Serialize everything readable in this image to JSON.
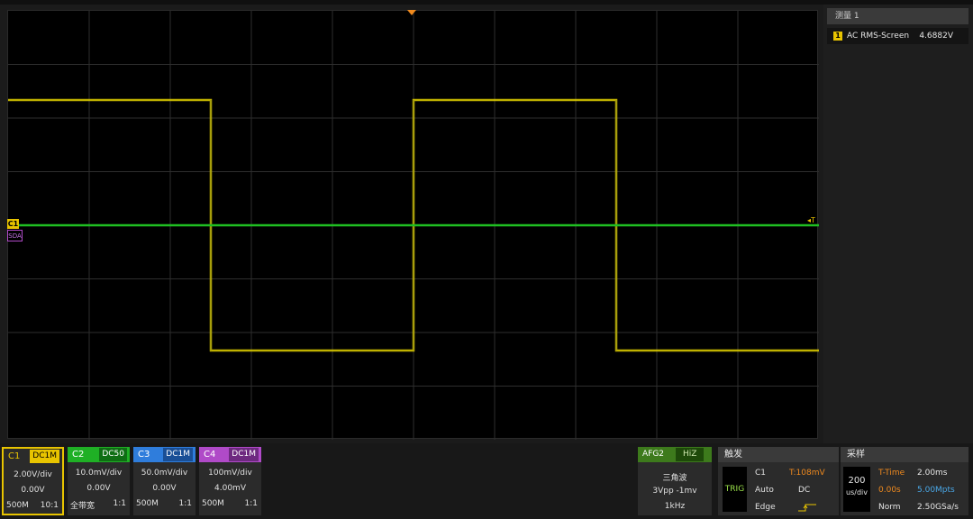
{
  "measurement": {
    "title": "测量 1",
    "channel_badge": "1",
    "name": "AC RMS-Screen",
    "value": "4.6882V"
  },
  "waveform": {
    "channel_marker": "C1",
    "bus_label": "SDA",
    "trigger_level_marker": "◂T",
    "colors": {
      "ch1": "#e0d000",
      "ch2": "#1fbf22",
      "grid": "#2e2e2e"
    }
  },
  "channels": [
    {
      "name": "C1",
      "coupling": "DC1M",
      "scale": "2.00V/div",
      "offset": "0.00V",
      "bandwidth": "500M",
      "probe": "10:1",
      "color": "#e8c400",
      "active": true
    },
    {
      "name": "C2",
      "coupling": "DC50",
      "scale": "10.0mV/div",
      "offset": "0.00V",
      "bandwidth": "全带宽",
      "probe": "1:1",
      "color": "#1fb025",
      "active": false
    },
    {
      "name": "C3",
      "coupling": "DC1M",
      "scale": "50.0mV/div",
      "offset": "0.00V",
      "bandwidth": "500M",
      "probe": "1:1",
      "color": "#2f7ddc",
      "active": false
    },
    {
      "name": "C4",
      "coupling": "DC1M",
      "scale": "100mV/div",
      "offset": "4.00mV",
      "bandwidth": "500M",
      "probe": "1:1",
      "color": "#b04ac8",
      "active": false
    }
  ],
  "afg": {
    "name": "AFG2",
    "impedance": "HiZ",
    "wave": "三角波",
    "amplitude": "3Vpp -1mv",
    "frequency": "1kHz"
  },
  "trigger": {
    "title": "触发",
    "tag": "TRIG",
    "source": "C1",
    "level": "T:108mV",
    "mode": "Auto",
    "coupling": "DC",
    "type": "Edge"
  },
  "acquire": {
    "title": "采样",
    "timebase_value": "200",
    "timebase_unit": "us/div",
    "ttime_label": "T-Time",
    "ttime_value": "2.00ms",
    "delay": "0.00s",
    "memory": "5.00Mpts",
    "mode": "Norm",
    "sample_rate": "2.50GSa/s"
  }
}
